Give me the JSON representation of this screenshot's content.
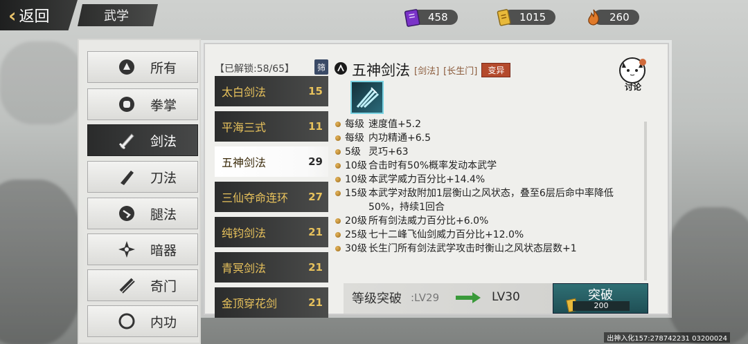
{
  "header": {
    "back_label": "返回",
    "section_title": "武学",
    "resources": [
      {
        "icon": "purple-book-icon",
        "value": "458",
        "color": "#8a3fd6"
      },
      {
        "icon": "gold-token-icon",
        "value": "1015",
        "color": "#e8b93a"
      },
      {
        "icon": "flame-token-icon",
        "value": "260",
        "color": "#e07a2a"
      }
    ]
  },
  "categories": [
    {
      "label": "所有",
      "icon": "all-icon"
    },
    {
      "label": "拳掌",
      "icon": "fist-icon"
    },
    {
      "label": "剑法",
      "icon": "sword-icon",
      "active": true
    },
    {
      "label": "刀法",
      "icon": "blade-icon"
    },
    {
      "label": "腿法",
      "icon": "kick-icon"
    },
    {
      "label": "暗器",
      "icon": "shuriken-icon"
    },
    {
      "label": "奇门",
      "icon": "exotic-weapon-icon"
    },
    {
      "label": "内功",
      "icon": "inner-power-icon"
    }
  ],
  "skill_list": {
    "header": "【已解锁:58/65】",
    "filter_label": "筛",
    "items": [
      {
        "name": "太白剑法",
        "level": "15"
      },
      {
        "name": "平海三式",
        "level": "11"
      },
      {
        "name": "五神剑法",
        "level": "29",
        "selected": true
      },
      {
        "name": "三仙夺命连环",
        "level": "27"
      },
      {
        "name": "纯钧剑法",
        "level": "21"
      },
      {
        "name": "青冥剑法",
        "level": "21"
      },
      {
        "name": "金顶穿花剑",
        "level": "21"
      }
    ]
  },
  "detail": {
    "name": "五神剑法",
    "type_tag": "[剑法]",
    "sect_tag": "[长生门]",
    "badge": "变异",
    "discuss_label": "讨论",
    "effects": [
      {
        "level": "每级",
        "text": "速度值+5.2"
      },
      {
        "level": "每级",
        "text": "内功精通+6.5"
      },
      {
        "level": "5级",
        "text": "灵巧+63"
      },
      {
        "level": "10级",
        "text": "合击时有50%概率发动本武学"
      },
      {
        "level": "10级",
        "text": "本武学威力百分比+14.4%"
      },
      {
        "level": "15级",
        "text": "本武学对敌附加1层衡山之风状态，叠至6层后命中率降低50%，持续1回合"
      },
      {
        "level": "20级",
        "text": "所有剑法威力百分比+6.0%"
      },
      {
        "level": "25级",
        "text": "七十二峰飞仙剑威力百分比+12.0%"
      },
      {
        "level": "30级",
        "text": "长生门所有剑法武学攻击时衡山之风状态层数+1"
      }
    ]
  },
  "breakthrough": {
    "label": "等级突破",
    "from": ":LV29",
    "to": "LV30",
    "button_label": "突破",
    "cost": "200"
  },
  "footer_id": "出神入化157:278742231  03200024"
}
